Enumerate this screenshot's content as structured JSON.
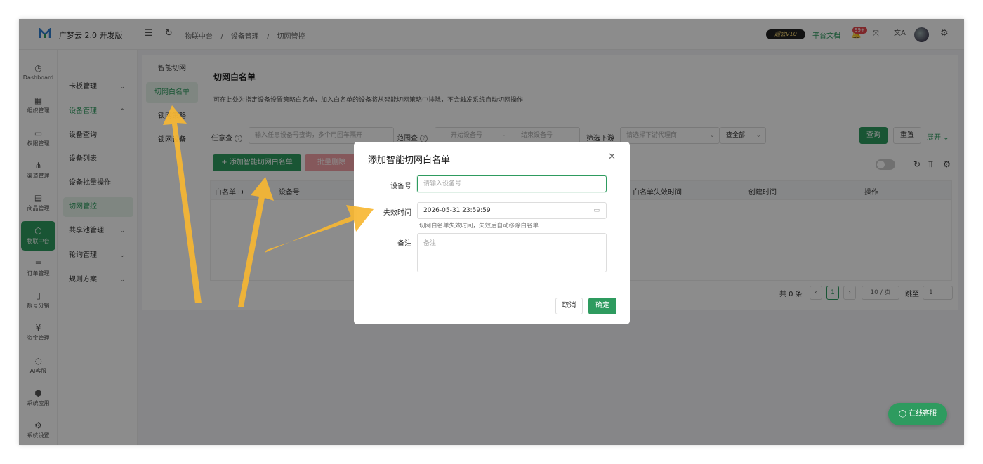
{
  "app": {
    "brand": "广梦云 2.0 开发版"
  },
  "header": {
    "breadcrumb": [
      "物联中台",
      "/",
      "设备管理",
      "/",
      "切网管控"
    ],
    "vip_badge": "超会V10",
    "docs_link": "平台文档",
    "notification_count": "99+",
    "icons": [
      "menu-fold-icon",
      "refresh-icon",
      "fullscreen-icon",
      "translate-icon",
      "settings-icon"
    ]
  },
  "sidebar_main": [
    {
      "label": "Dashboard",
      "icon": "dashboard-icon"
    },
    {
      "label": "组织管理",
      "icon": "grid-icon"
    },
    {
      "label": "权限管理",
      "icon": "monitor-icon"
    },
    {
      "label": "渠道管理",
      "icon": "network-icon"
    },
    {
      "label": "商品管理",
      "icon": "store-icon"
    },
    {
      "label": "物联中台",
      "icon": "iot-icon",
      "active": true
    },
    {
      "label": "订单管理",
      "icon": "list-icon"
    },
    {
      "label": "靓号分销",
      "icon": "phone-icon"
    },
    {
      "label": "资金管理",
      "icon": "money-icon"
    },
    {
      "label": "AI客服",
      "icon": "ai-icon"
    },
    {
      "label": "系统应用",
      "icon": "cube-icon"
    },
    {
      "label": "系统设置",
      "icon": "gear-icon"
    }
  ],
  "sidebar_sub": [
    {
      "label": "卡板管理",
      "chevron": "⌄"
    },
    {
      "label": "设备管理",
      "chevron": "⌃",
      "green": true
    },
    {
      "label": "设备查询"
    },
    {
      "label": "设备列表"
    },
    {
      "label": "设备批量操作"
    },
    {
      "label": "切网管控",
      "active": true
    },
    {
      "label": "共享池管理",
      "chevron": "⌄"
    },
    {
      "label": "轮询管理",
      "chevron": "⌄"
    },
    {
      "label": "规则方案",
      "chevron": "⌄"
    }
  ],
  "subnav": [
    "智能切网",
    "切网白名单",
    "锁网策略",
    "锁网设备"
  ],
  "page": {
    "title": "切网白名单",
    "description": "可在此处为指定设备设置策略白名单，加入白名单的设备将从智能切网策略中排除，不会触发系统自动切网操作"
  },
  "filters": {
    "any_label": "任意查",
    "any_placeholder": "输入任意设备号查询，多个用回车隔开",
    "range_label": "范围查",
    "range_start_placeholder": "开始设备号",
    "range_sep": "-",
    "range_end_placeholder": "结束设备号",
    "downstream_label": "筛选下游",
    "downstream_placeholder": "请选择下游代理商",
    "scope_value": "查全部",
    "query_button": "查询",
    "reset_button": "重置",
    "expand_button": "展开 ⌄"
  },
  "actions": {
    "add_button": "+ 添加智能切网白名单",
    "batch_delete_button": "批量删除"
  },
  "table": {
    "columns": [
      "白名单ID",
      "设备号",
      "白名单失效时间",
      "创建时间",
      "操作"
    ]
  },
  "pagination": {
    "total": "共 0 条",
    "current_page": "1",
    "page_size": "10 / 页",
    "jump_label": "跳至",
    "jump_value": "1"
  },
  "modal": {
    "title": "添加智能切网白名单",
    "device_label": "设备号",
    "device_placeholder": "请输入设备号",
    "expire_label": "失效时间",
    "expire_value": "2026-05-31 23:59:59",
    "expire_help": "切网白名单失效时间，失效后自动移除白名单",
    "remark_label": "备注",
    "remark_placeholder": "备注",
    "cancel_button": "取消",
    "confirm_button": "确定"
  },
  "chat_button": "在线客服",
  "annotation_color": "#f7b733"
}
